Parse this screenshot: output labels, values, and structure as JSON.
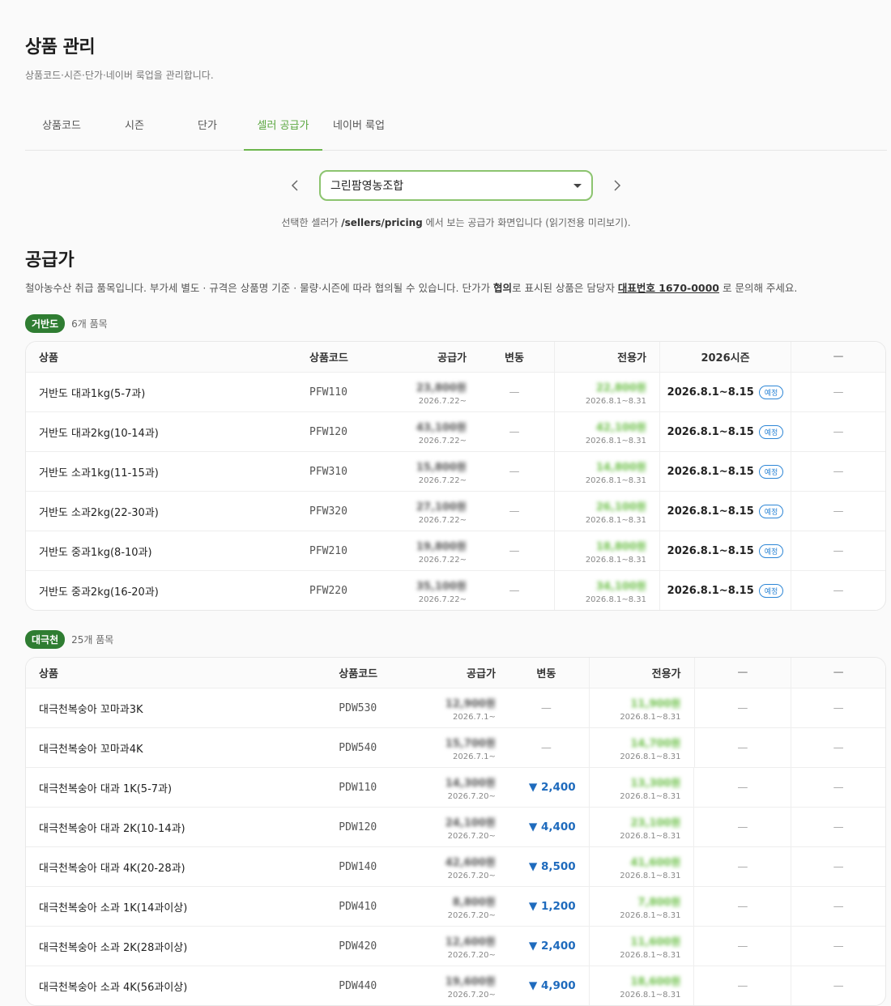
{
  "header": {
    "title": "상품 관리",
    "subtitle": "상품코드·시즌·단가·네이버 룩업을 관리합니다."
  },
  "tabs": [
    {
      "label": "상품코드"
    },
    {
      "label": "시즌"
    },
    {
      "label": "단가"
    },
    {
      "label": "셀러 공급가"
    },
    {
      "label": "네이버 룩업"
    }
  ],
  "seller": {
    "selected": "그린팜영농조합",
    "note_pre": "선택한 셀러가 ",
    "note_path": "/sellers/pricing",
    "note_post": " 에서 보는 공급가 화면입니다 (읽기전용 미리보기)."
  },
  "pricing": {
    "title": "공급가",
    "desc_pre": "철아농수산 취급 품목입니다. 부가세 별도 · 규격은 상품명 기준 · 물량·시즌에 따라 협의될 수 있습니다. 단가가 ",
    "desc_bold": "협의",
    "desc_mid": "로 표시된 상품은 담당자 ",
    "desc_phone": "대표번호 1670-0000",
    "desc_post": " 로 문의해 주세요."
  },
  "group1": {
    "badge": "거반도",
    "count": "6개 품목",
    "headers": {
      "product": "상품",
      "code": "상품코드",
      "supply": "공급가",
      "change": "변동",
      "exclusive": "전용가",
      "season": "2026시즌",
      "extra": "—"
    },
    "rows": [
      {
        "product": "거반도 대과1kg(5-7과)",
        "code": "PFW110",
        "supply": "23,800원",
        "supply_date": "2026.7.22~",
        "change": "—",
        "exclusive": "22,800원",
        "exclusive_date": "2026.8.1~8.31",
        "season": "2026.8.1~8.15",
        "season_tag": "예정",
        "extra": "—"
      },
      {
        "product": "거반도 대과2kg(10-14과)",
        "code": "PFW120",
        "supply": "43,100원",
        "supply_date": "2026.7.22~",
        "change": "—",
        "exclusive": "42,100원",
        "exclusive_date": "2026.8.1~8.31",
        "season": "2026.8.1~8.15",
        "season_tag": "예정",
        "extra": "—"
      },
      {
        "product": "거반도 소과1kg(11-15과)",
        "code": "PFW310",
        "supply": "15,800원",
        "supply_date": "2026.7.22~",
        "change": "—",
        "exclusive": "14,800원",
        "exclusive_date": "2026.8.1~8.31",
        "season": "2026.8.1~8.15",
        "season_tag": "예정",
        "extra": "—"
      },
      {
        "product": "거반도 소과2kg(22-30과)",
        "code": "PFW320",
        "supply": "27,100원",
        "supply_date": "2026.7.22~",
        "change": "—",
        "exclusive": "26,100원",
        "exclusive_date": "2026.8.1~8.31",
        "season": "2026.8.1~8.15",
        "season_tag": "예정",
        "extra": "—"
      },
      {
        "product": "거반도 중과1kg(8-10과)",
        "code": "PFW210",
        "supply": "19,800원",
        "supply_date": "2026.7.22~",
        "change": "—",
        "exclusive": "18,800원",
        "exclusive_date": "2026.8.1~8.31",
        "season": "2026.8.1~8.15",
        "season_tag": "예정",
        "extra": "—"
      },
      {
        "product": "거반도 중과2kg(16-20과)",
        "code": "PFW220",
        "supply": "35,100원",
        "supply_date": "2026.7.22~",
        "change": "—",
        "exclusive": "34,100원",
        "exclusive_date": "2026.8.1~8.31",
        "season": "2026.8.1~8.15",
        "season_tag": "예정",
        "extra": "—"
      }
    ]
  },
  "group2": {
    "badge": "대극천",
    "count": "25개 품목",
    "headers": {
      "product": "상품",
      "code": "상품코드",
      "supply": "공급가",
      "change": "변동",
      "exclusive": "전용가",
      "col6": "—",
      "col7": "—"
    },
    "rows": [
      {
        "product": "대극천복숭아 꼬마과3K",
        "code": "PDW530",
        "supply": "12,900원",
        "supply_date": "2026.7.1~",
        "change": "—",
        "exclusive": "11,900원",
        "exclusive_date": "2026.8.1~8.31",
        "col6": "—",
        "col7": "—"
      },
      {
        "product": "대극천복숭아 꼬마과4K",
        "code": "PDW540",
        "supply": "15,700원",
        "supply_date": "2026.7.1~",
        "change": "—",
        "exclusive": "14,700원",
        "exclusive_date": "2026.8.1~8.31",
        "col6": "—",
        "col7": "—"
      },
      {
        "product": "대극천복숭아 대과 1K(5-7과)",
        "code": "PDW110",
        "supply": "14,300원",
        "supply_date": "2026.7.20~",
        "change": "▼ 2,400",
        "exclusive": "13,300원",
        "exclusive_date": "2026.8.1~8.31",
        "col6": "—",
        "col7": "—"
      },
      {
        "product": "대극천복숭아 대과 2K(10-14과)",
        "code": "PDW120",
        "supply": "24,100원",
        "supply_date": "2026.7.20~",
        "change": "▼ 4,400",
        "exclusive": "23,100원",
        "exclusive_date": "2026.8.1~8.31",
        "col6": "—",
        "col7": "—"
      },
      {
        "product": "대극천복숭아 대과 4K(20-28과)",
        "code": "PDW140",
        "supply": "42,600원",
        "supply_date": "2026.7.20~",
        "change": "▼ 8,500",
        "exclusive": "41,600원",
        "exclusive_date": "2026.8.1~8.31",
        "col6": "—",
        "col7": "—"
      },
      {
        "product": "대극천복숭아 소과 1K(14과이상)",
        "code": "PDW410",
        "supply": "8,800원",
        "supply_date": "2026.7.20~",
        "change": "▼ 1,200",
        "exclusive": "7,800원",
        "exclusive_date": "2026.8.1~8.31",
        "col6": "—",
        "col7": "—"
      },
      {
        "product": "대극천복숭아 소과 2K(28과이상)",
        "code": "PDW420",
        "supply": "12,600원",
        "supply_date": "2026.7.20~",
        "change": "▼ 2,400",
        "exclusive": "11,600원",
        "exclusive_date": "2026.8.1~8.31",
        "col6": "—",
        "col7": "—"
      },
      {
        "product": "대극천복숭아 소과 4K(56과이상)",
        "code": "PDW440",
        "supply": "19,600원",
        "supply_date": "2026.7.20~",
        "change": "▼ 4,900",
        "exclusive": "18,600원",
        "exclusive_date": "2026.8.1~8.31",
        "col6": "—",
        "col7": "—"
      }
    ]
  }
}
